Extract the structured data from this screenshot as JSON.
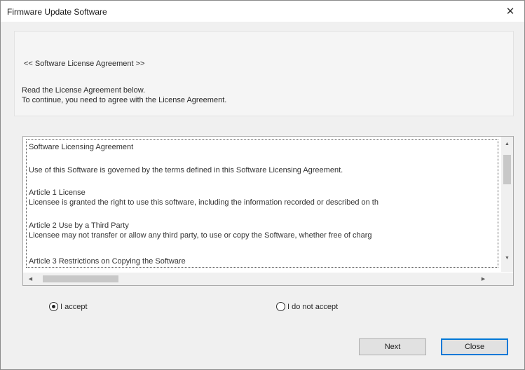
{
  "window": {
    "title": "Firmware Update Software",
    "close_glyph": "✕"
  },
  "header": {
    "heading": "<< Software License Agreement >>",
    "instruction_line1": "Read the License Agreement below.",
    "instruction_line2": "To continue, you need to agree with the License Agreement."
  },
  "license": {
    "lines": [
      "Software Licensing Agreement",
      "Use of this Software is governed by the terms defined in this Software Licensing Agreement.",
      "Article 1 License",
      "Licensee is granted the right to use this software, including the information recorded or described on th",
      "Article 2 Use by a Third Party",
      "Licensee may not transfer or allow any third party, to use or copy the Software, whether free of charg",
      "Article 3 Restrictions on Copying the Software"
    ],
    "scroll_up_glyph": "▲",
    "scroll_down_glyph": "▼",
    "scroll_left_glyph": "◀",
    "scroll_right_glyph": "▶"
  },
  "options": {
    "accept_label": "I accept",
    "accept_selected": true,
    "decline_label": "I do not accept",
    "decline_selected": false
  },
  "buttons": {
    "next_label": "Next",
    "close_label": "Close"
  }
}
